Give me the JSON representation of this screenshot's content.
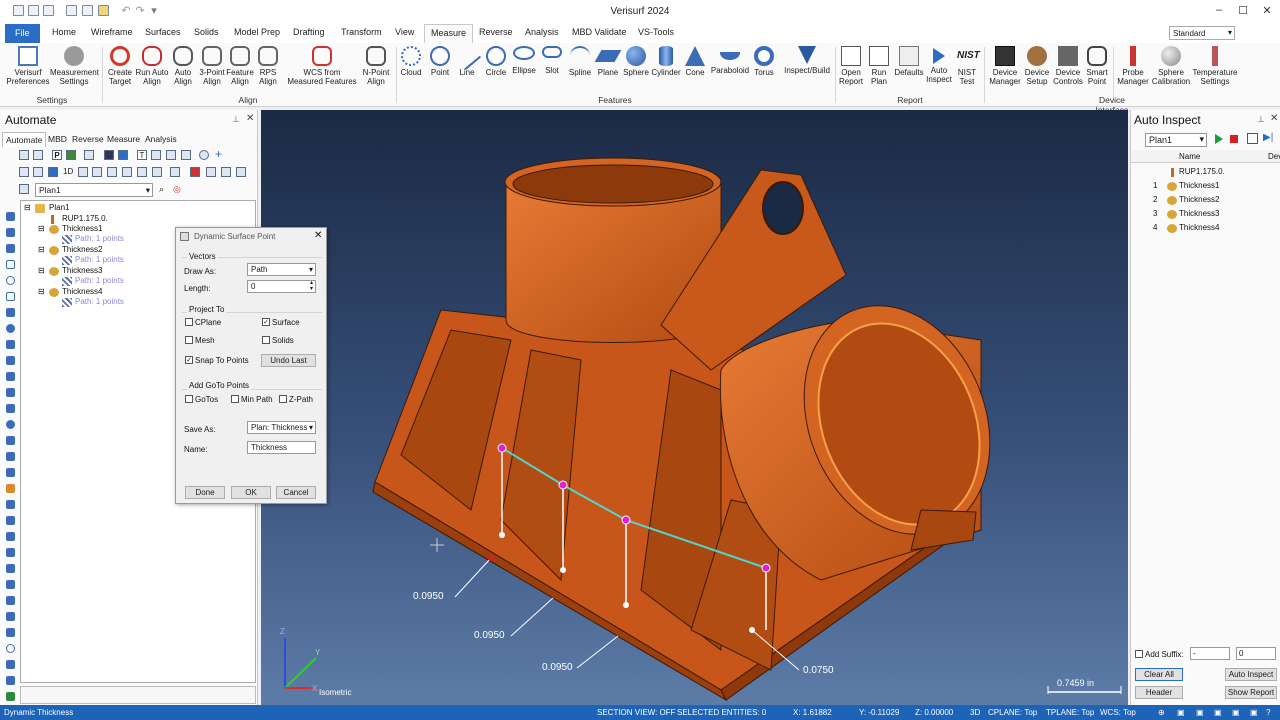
{
  "app": {
    "title": "Verisurf 2024"
  },
  "ribbon": {
    "tabs": [
      "File",
      "Home",
      "Wireframe",
      "Surfaces",
      "Solids",
      "Model Prep",
      "Drafting",
      "Transform",
      "View",
      "Measure",
      "Reverse",
      "Analysis",
      "MBD Validate",
      "VS-Tools"
    ],
    "active_tab": "Measure",
    "standard_combo": "Standard",
    "groups": {
      "settings": "Settings",
      "align": "Align",
      "features": "Features",
      "report": "Report",
      "device_interface": "Device Interface"
    },
    "buttons": {
      "verisurf_preferences": [
        "Verisurf",
        "Preferences"
      ],
      "measurement_settings": [
        "Measurement",
        "Settings"
      ],
      "create_target": [
        "Create",
        "Target"
      ],
      "run_auto_align": [
        "Run Auto",
        "Align"
      ],
      "auto_align": [
        "Auto",
        "Align"
      ],
      "three_point_align": [
        "3-Point",
        "Align"
      ],
      "feature_align": [
        "Feature",
        "Align"
      ],
      "rps_align": [
        "RPS",
        "Align"
      ],
      "wcs_from_measured": [
        "WCS from",
        "Measured Features"
      ],
      "n_point_align": [
        "N-Point",
        "Align"
      ],
      "cloud": [
        "Cloud"
      ],
      "point": [
        "Point"
      ],
      "line": [
        "Line"
      ],
      "circle": [
        "Circle"
      ],
      "ellipse": [
        "Ellipse"
      ],
      "slot": [
        "Slot"
      ],
      "spline": [
        "Spline"
      ],
      "plane": [
        "Plane"
      ],
      "sphere": [
        "Sphere"
      ],
      "cylinder": [
        "Cylinder"
      ],
      "cone": [
        "Cone"
      ],
      "paraboloid": [
        "Paraboloid"
      ],
      "torus": [
        "Torus"
      ],
      "inspect_build": [
        "Inspect/Build"
      ],
      "open_report": [
        "Open",
        "Report"
      ],
      "run_plan": [
        "Run",
        "Plan"
      ],
      "defaults": [
        "Defaults"
      ],
      "auto_inspect": [
        "Auto",
        "Inspect"
      ],
      "nist_test": [
        "NIST",
        "Test"
      ],
      "nist_icon_text": "NIST",
      "device_manager": [
        "Device",
        "Manager"
      ],
      "device_setup": [
        "Device",
        "Setup"
      ],
      "device_controls": [
        "Device",
        "Controls"
      ],
      "smart_point": [
        "Smart",
        "Point"
      ],
      "probe_manager": [
        "Probe",
        "Manager"
      ],
      "sphere_calibration": [
        "Sphere",
        "Calibration"
      ],
      "temperature_settings": [
        "Temperature",
        "Settings"
      ]
    }
  },
  "left_panel": {
    "title": "Automate",
    "subtabs": [
      "Automate",
      "MBD",
      "Reverse",
      "Measure",
      "Analysis"
    ],
    "plan_combo": "Plan1",
    "tree": {
      "root": "Plan1",
      "rup": "RUP1.175.0.",
      "items": [
        {
          "name": "Thickness1",
          "path": "Path: 1 points"
        },
        {
          "name": "Thickness2",
          "path": "Path: 1 points"
        },
        {
          "name": "Thickness3",
          "path": "Path: 1 points"
        },
        {
          "name": "Thickness4",
          "path": "Path: 1 points"
        }
      ]
    }
  },
  "dialog": {
    "title": "Dynamic Surface Point",
    "vectors_label": "Vectors",
    "draw_as_label": "Draw As:",
    "draw_as_value": "Path",
    "length_label": "Length:",
    "length_value": "0",
    "project_to_label": "Project To",
    "cplane": {
      "label": "CPlane",
      "checked": false
    },
    "surface": {
      "label": "Surface",
      "checked": true
    },
    "mesh": {
      "label": "Mesh",
      "checked": false
    },
    "solids": {
      "label": "Solids",
      "checked": false
    },
    "snap_to_points": {
      "label": "Snap To Points",
      "checked": true
    },
    "undo_last": "Undo Last",
    "add_goto_label": "Add GoTo Points",
    "gotos": {
      "label": "GoTos",
      "checked": false
    },
    "min_path": {
      "label": "Min Path",
      "checked": false
    },
    "z_path": {
      "label": "Z-Path",
      "checked": false
    },
    "save_as_label": "Save As:",
    "save_as_value": "Plan: Thickness (",
    "name_label": "Name:",
    "name_value": "Thickness",
    "done": "Done",
    "ok": "OK",
    "cancel": "Cancel"
  },
  "viewport": {
    "labels": [
      "0.0950",
      "0.0950",
      "0.0950",
      "0.0750"
    ],
    "scale": "0.7459 in",
    "view_name": "Isometric",
    "axis_labels": {
      "z": "Z",
      "y": "Y",
      "x": "X"
    }
  },
  "right_panel": {
    "title": "Auto Inspect",
    "plan_combo": "Plan1",
    "col_name": "Name",
    "col_dev": "Dev",
    "rup": "RUP1.175.0.",
    "rows": [
      {
        "num": "1",
        "name": "Thickness1"
      },
      {
        "num": "2",
        "name": "Thickness2"
      },
      {
        "num": "3",
        "name": "Thickness3"
      },
      {
        "num": "4",
        "name": "Thickness4"
      }
    ],
    "add_suffix_label": "Add Suffix:",
    "suffix_value": "-",
    "suffix_number": "0",
    "clear_all": "Clear All",
    "auto_inspect": "Auto Inspect",
    "header": "Header",
    "show_report": "Show Report"
  },
  "status": {
    "mode": "Dynamic Thickness",
    "section_view": "SECTION VIEW: OFF",
    "selected": "SELECTED ENTITIES: 0",
    "x": "X:   1.61882",
    "y": "Y:   -0.11029",
    "z": "Z:   0.00000",
    "dim": "3D",
    "cplane": "CPLANE: Top",
    "tplane": "TPLANE: Top",
    "wcs": "WCS: Top"
  },
  "colors": {
    "accent": "#2b6cc4",
    "status_bar": "#1d63b8",
    "part": "#d4631f",
    "path_line": "#4fd6d0",
    "path_point": "#e61ed2"
  }
}
